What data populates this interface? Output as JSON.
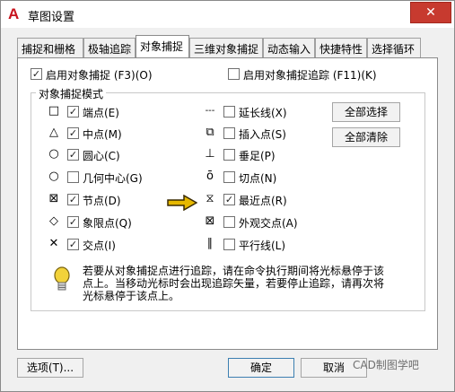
{
  "window": {
    "title": "草图设置",
    "app_icon": "autocad-a-logo",
    "close_symbol": "✕"
  },
  "tabs": [
    {
      "label": "捕捉和栅格",
      "active": false
    },
    {
      "label": "极轴追踪",
      "active": false
    },
    {
      "label": "对象捕捉",
      "active": true
    },
    {
      "label": "三维对象捕捉",
      "active": false
    },
    {
      "label": "动态输入",
      "active": false
    },
    {
      "label": "快捷特性",
      "active": false
    },
    {
      "label": "选择循环",
      "active": false
    }
  ],
  "toggles": {
    "osnap_on": {
      "label": "启用对象捕捉 (F3)(O)",
      "checked": true
    },
    "tracking_on": {
      "label": "启用对象捕捉追踪 (F11)(K)",
      "checked": false
    }
  },
  "group_title": "对象捕捉模式",
  "modes_left": [
    {
      "symbol": "□",
      "label": "端点(E)",
      "checked": true
    },
    {
      "symbol": "△",
      "label": "中点(M)",
      "checked": true
    },
    {
      "symbol": "○",
      "label": "圆心(C)",
      "checked": true
    },
    {
      "symbol": "○",
      "label": "几何中心(G)",
      "checked": false
    },
    {
      "symbol": "⊠",
      "label": "节点(D)",
      "checked": true
    },
    {
      "symbol": "◇",
      "label": "象限点(Q)",
      "checked": true
    },
    {
      "symbol": "✕",
      "label": "交点(I)",
      "checked": true
    }
  ],
  "modes_right": [
    {
      "symbol": "---",
      "label": "延长线(X)",
      "checked": false
    },
    {
      "symbol": "⧉",
      "label": "插入点(S)",
      "checked": false
    },
    {
      "symbol": "⊥",
      "label": "垂足(P)",
      "checked": false
    },
    {
      "symbol": "ō",
      "label": "切点(N)",
      "checked": false
    },
    {
      "symbol": "⧖",
      "label": "最近点(R)",
      "checked": true
    },
    {
      "symbol": "⊠",
      "label": "外观交点(A)",
      "checked": false
    },
    {
      "symbol": "∥",
      "label": "平行线(L)",
      "checked": false
    }
  ],
  "buttons": {
    "select_all": "全部选择",
    "clear_all": "全部清除",
    "options": "选项(T)...",
    "ok": "确定",
    "cancel": "取消"
  },
  "info_text": "若要从对象捕捉点进行追踪，请在命令执行期间将光标悬停于该点上。当移动光标时会出现追踪矢量，若要停止追踪，请再次将光标悬停于该点上。",
  "watermark": "CAD制图学吧",
  "colors": {
    "close_button": "#c73a2f",
    "arrow": "#e6b800",
    "info_bulb": "#f2d23a"
  }
}
